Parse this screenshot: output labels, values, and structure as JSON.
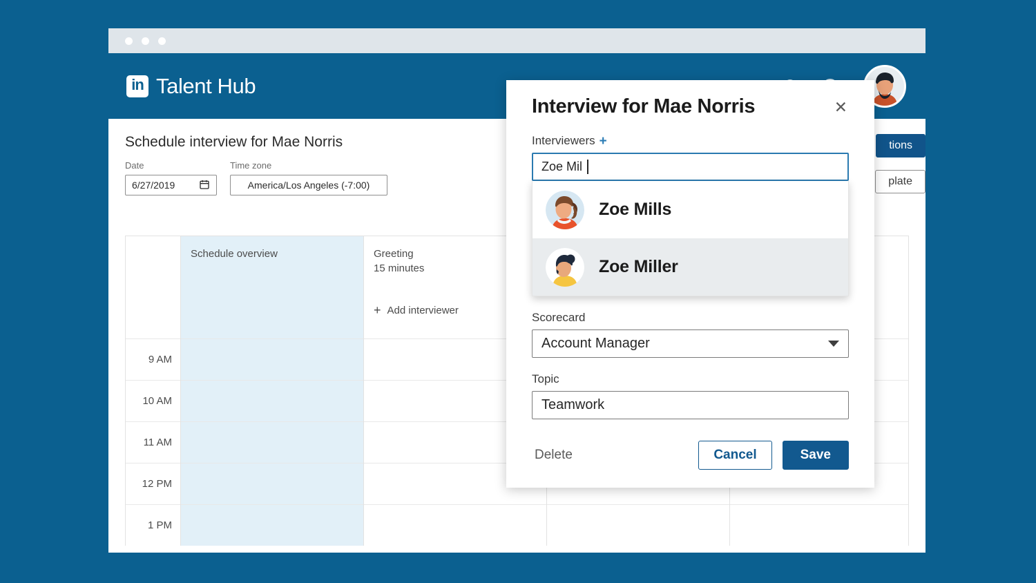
{
  "window": {
    "dots": [
      "close",
      "minimize",
      "maximize"
    ]
  },
  "header": {
    "logo_text": "in",
    "brand": "Talent Hub",
    "nav_icons": [
      "jobs-icon",
      "search-icon",
      "help-icon"
    ],
    "avatar": "user-avatar"
  },
  "page": {
    "title": "Schedule interview for Mae Norris",
    "date_label": "Date",
    "date_value": "6/27/2019",
    "calendar_icon": "calendar-icon",
    "timezone_label": "Time zone",
    "timezone_value": "America/Los Angeles (-7:00)",
    "actions": {
      "primary_partial": "tions",
      "secondary_partial": "plate"
    }
  },
  "calendar": {
    "columns": [
      {
        "title": "",
        "subtitle": ""
      },
      {
        "title": "Schedule overview",
        "subtitle": ""
      },
      {
        "title": "Greeting",
        "subtitle": "15 minutes",
        "add_label": "Add interviewer",
        "add_icon": "plus-icon"
      }
    ],
    "times": [
      "9 AM",
      "10 AM",
      "11 AM",
      "12 PM",
      "1 PM"
    ]
  },
  "modal": {
    "title": "Interview for Mae Norris",
    "close_icon": "close-icon",
    "interviewers_label": "Interviewers",
    "interviewers_add_icon": "plus-icon",
    "interviewers_value": "Zoe Mil",
    "suggestions": [
      {
        "name": "Zoe Mills",
        "active": false
      },
      {
        "name": "Zoe Miller",
        "active": true
      }
    ],
    "scorecard_label": "Scorecard",
    "scorecard_value": "Account Manager",
    "scorecard_icon": "chevron-down-icon",
    "topic_label": "Topic",
    "topic_value": "Teamwork",
    "delete_label": "Delete",
    "cancel_label": "Cancel",
    "save_label": "Save"
  },
  "colors": {
    "brand_blue": "#0b6090",
    "button_blue": "#12598f",
    "overview_column": "#e2f0f8",
    "focus_border": "#2a7ab0",
    "suggestion_active": "#e9ecee"
  }
}
